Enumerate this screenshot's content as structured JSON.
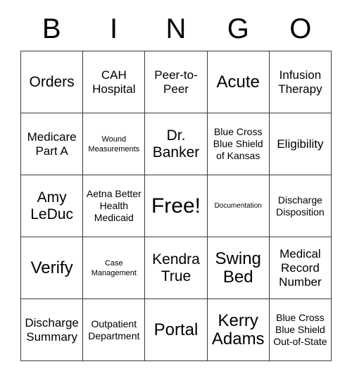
{
  "card": {
    "title": "BINGO Card",
    "header_letters": [
      "B",
      "I",
      "N",
      "G",
      "O"
    ],
    "grid_line_color": "#3a3a3a",
    "background_color": "#ffffff",
    "text_color": "#000000",
    "rows": [
      [
        {
          "text": "Orders",
          "size": "lg"
        },
        {
          "text": "CAH Hospital",
          "size": "md"
        },
        {
          "text": "Peer-to-Peer",
          "size": "md"
        },
        {
          "text": "Acute",
          "size": "xl"
        },
        {
          "text": "Infusion Therapy",
          "size": "md"
        }
      ],
      [
        {
          "text": "Medicare Part A",
          "size": "md"
        },
        {
          "text": "Wound Measurements",
          "size": "xs"
        },
        {
          "text": "Dr. Banker",
          "size": "lg"
        },
        {
          "text": "Blue Cross Blue Shield of Kansas",
          "size": "sm"
        },
        {
          "text": "Eligibility",
          "size": "md"
        }
      ],
      [
        {
          "text": "Amy LeDuc",
          "size": "lg"
        },
        {
          "text": "Aetna Better Health Medicaid",
          "size": "sm"
        },
        {
          "text": "Free!",
          "size": "xxl"
        },
        {
          "text": "Documentation",
          "size": "xxs"
        },
        {
          "text": "Discharge Disposition",
          "size": "sm"
        }
      ],
      [
        {
          "text": "Verify",
          "size": "xl"
        },
        {
          "text": "Case Management",
          "size": "xs"
        },
        {
          "text": "Kendra True",
          "size": "lg"
        },
        {
          "text": "Swing Bed",
          "size": "xl"
        },
        {
          "text": "Medical Record Number",
          "size": "md"
        }
      ],
      [
        {
          "text": "Discharge Summary",
          "size": "md"
        },
        {
          "text": "Outpatient Department",
          "size": "sm"
        },
        {
          "text": "Portal",
          "size": "xl"
        },
        {
          "text": "Kerry Adams",
          "size": "xl"
        },
        {
          "text": "Blue Cross Blue Shield Out-of-State",
          "size": "sm"
        }
      ]
    ]
  }
}
